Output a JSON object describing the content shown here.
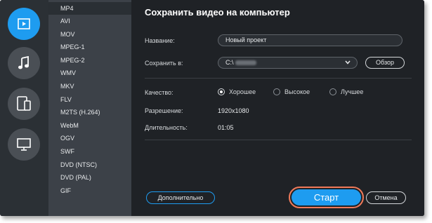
{
  "colors": {
    "accent": "#1e9cf0",
    "highlight_ring": "#f07a5a",
    "panel_bg": "#1f2226",
    "list_bg": "#3c4148"
  },
  "rail": {
    "items": [
      {
        "icon": "video-play-icon",
        "active": true
      },
      {
        "icon": "music-note-icon",
        "active": false
      },
      {
        "icon": "devices-icon",
        "active": false
      },
      {
        "icon": "monitor-icon",
        "active": false
      }
    ]
  },
  "formats": {
    "selected": "MP4",
    "items": [
      "MP4",
      "AVI",
      "MOV",
      "MPEG-1",
      "MPEG-2",
      "WMV",
      "MKV",
      "FLV",
      "M2TS (H.264)",
      "WebM",
      "OGV",
      "SWF",
      "DVD (NTSC)",
      "DVD (PAL)",
      "GIF"
    ]
  },
  "panel": {
    "title": "Сохранить видео на компьютер",
    "name_label": "Название:",
    "name_value": "Новый проект",
    "save_to_label": "Сохранить в:",
    "save_to_value": "C:\\",
    "browse_label": "Обзор",
    "quality_label": "Качество:",
    "quality_options": [
      "Хорошее",
      "Высокое",
      "Лучшее"
    ],
    "quality_selected": "Хорошее",
    "resolution_label": "Разрешение:",
    "resolution_value": "1920x1080",
    "duration_label": "Длительность:",
    "duration_value": "01:05"
  },
  "footer": {
    "more_label": "Дополнительно",
    "start_label": "Старт",
    "cancel_label": "Отмена"
  }
}
